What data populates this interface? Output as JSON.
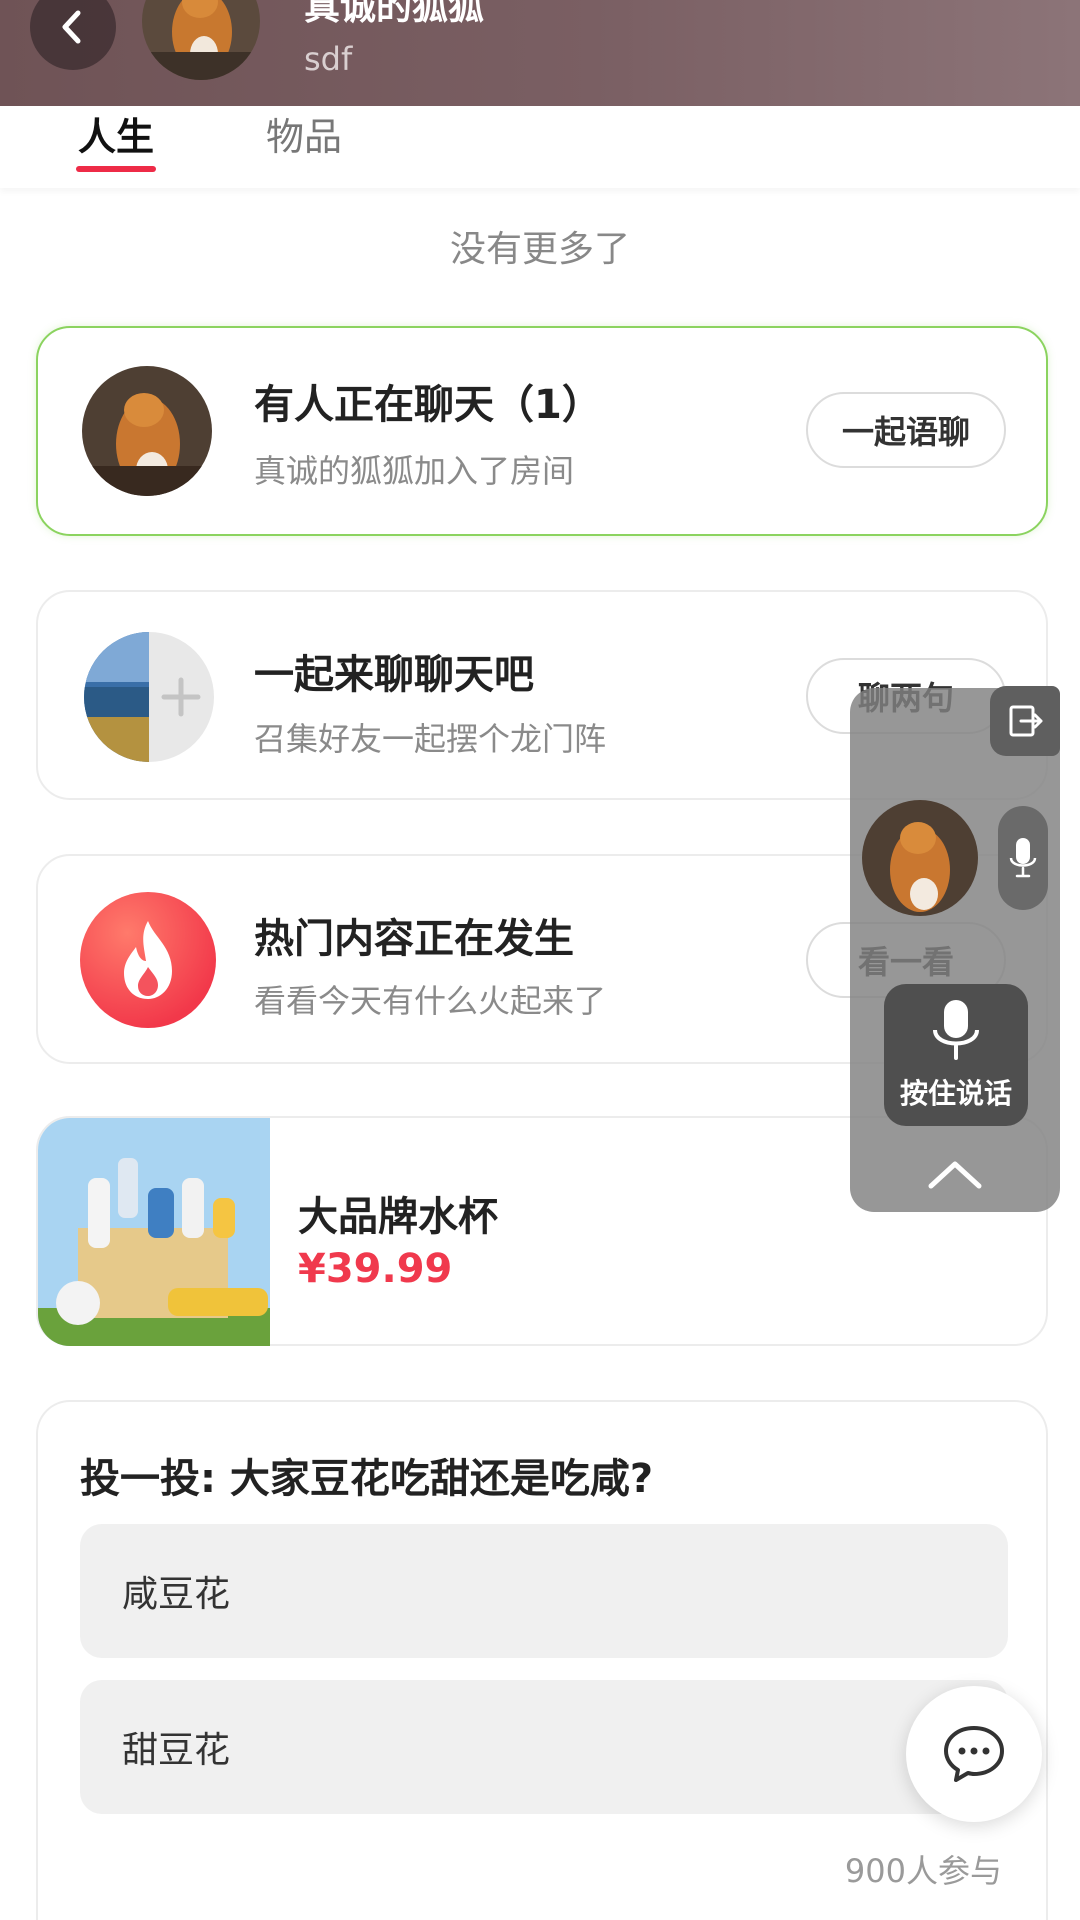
{
  "header": {
    "title": "真诚的狐狐",
    "subtitle": "sdf"
  },
  "tabs": [
    {
      "label": "人生",
      "active": true
    },
    {
      "label": "物品",
      "active": false
    }
  ],
  "feed": {
    "no_more": "没有更多了",
    "chat_room": {
      "title": "有人正在聊天（1）",
      "subtitle": "真诚的狐狐加入了房间",
      "button": "一起语聊"
    },
    "invite": {
      "title": "一起来聊聊天吧",
      "subtitle": "召集好友一起摆个龙门阵",
      "button": "聊两句"
    },
    "hot": {
      "title": "热门内容正在发生",
      "subtitle": "看看今天有什么火起来了",
      "button": "看一看"
    },
    "product": {
      "name": "大品牌水杯",
      "price": "¥39.99"
    },
    "poll": {
      "question": "投一投: 大家豆花吃甜还是吃咸?",
      "options": [
        "咸豆花",
        "甜豆花"
      ],
      "participants": "900人参与"
    }
  },
  "voice_panel": {
    "hold_to_talk": "按住说话"
  },
  "colors": {
    "accent": "#ee2b47",
    "price": "#f0394d",
    "active_border": "#8bd35f",
    "header_bg": "#735659"
  }
}
